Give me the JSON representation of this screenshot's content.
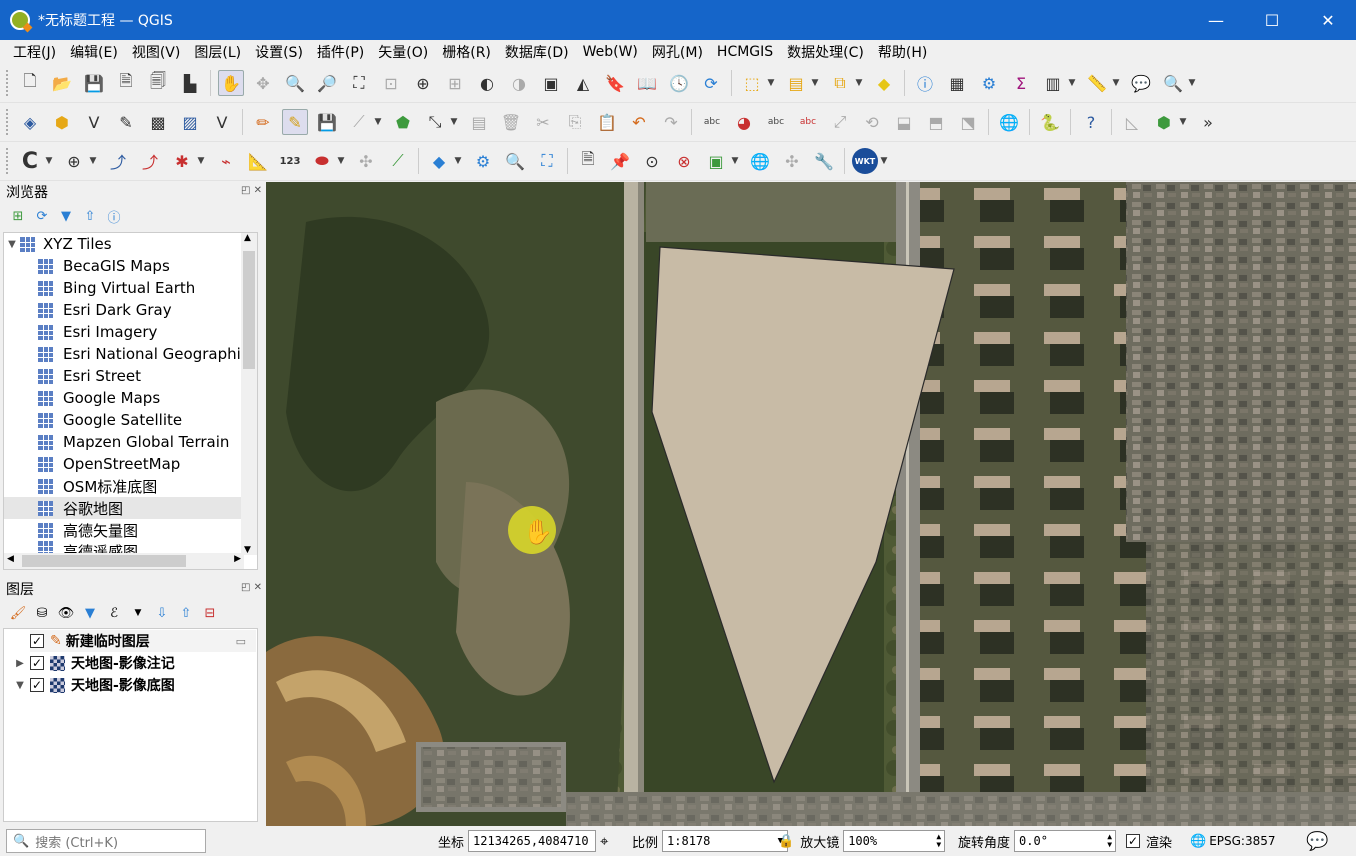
{
  "window": {
    "title": "*无标题工程 — QGIS",
    "controls": [
      "—",
      "☐",
      "✕"
    ]
  },
  "menu": [
    "工程(J)",
    "编辑(E)",
    "视图(V)",
    "图层(L)",
    "设置(S)",
    "插件(P)",
    "矢量(O)",
    "栅格(R)",
    "数据库(D)",
    "Web(W)",
    "网孔(M)",
    "HCMGIS",
    "数据处理(C)",
    "帮助(H)"
  ],
  "toolbar3_labels": {
    "numeric_label": "123",
    "wkt_label": "WKT"
  },
  "browser": {
    "title": "浏览器",
    "root": "XYZ Tiles",
    "items": [
      "BecaGIS Maps",
      "Bing Virtual Earth",
      "Esri Dark Gray",
      "Esri Imagery",
      "Esri National Geographic",
      "Esri Street",
      "Google Maps",
      "Google Satellite",
      "Mapzen Global Terrain",
      "OpenStreetMap",
      "OSM标准底图",
      "谷歌地图",
      "高德矢量图",
      "高德遥感图"
    ],
    "selected": "谷歌地图"
  },
  "layers": {
    "title": "图层",
    "items": [
      {
        "name": "新建临时图层",
        "checked": true
      },
      {
        "name": "天地图-影像注记",
        "checked": true
      },
      {
        "name": "天地图-影像底图",
        "checked": true
      }
    ]
  },
  "status": {
    "search_placeholder": "搜索 (Ctrl+K)",
    "coord_label": "坐标",
    "coord_value": "12134265,4084710",
    "scale_label": "比例",
    "scale_value": "1:8178",
    "magnifier_label": "放大镜",
    "magnifier_value": "100%",
    "rotation_label": "旋转角度",
    "rotation_value": "0.0°",
    "render_label": "渲染",
    "render_checked": true,
    "crs": "EPSG:3857"
  },
  "map": {
    "polygon_fill": "#c8bba6",
    "imagery_colors": [
      "#3a4a2c",
      "#4b5a37",
      "#6b6a4e",
      "#8c8a82"
    ]
  }
}
